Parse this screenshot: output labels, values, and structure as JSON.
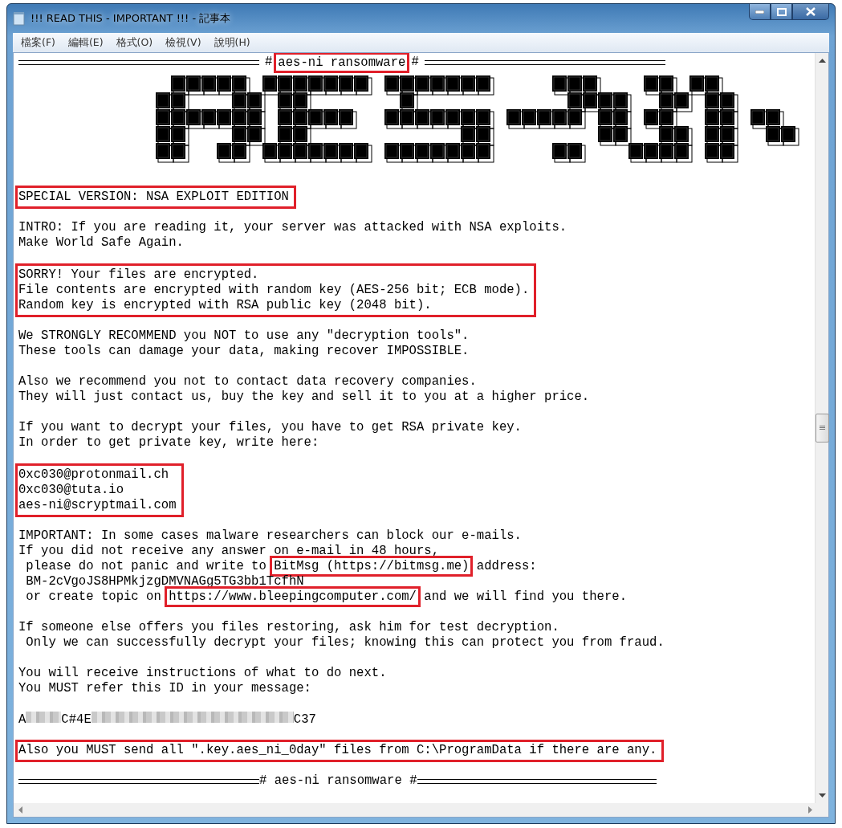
{
  "window": {
    "title": "!!! READ THIS - IMPORTANT !!! - 記事本"
  },
  "menu": [
    {
      "label": "檔案(F)"
    },
    {
      "label": "編輯(E)"
    },
    {
      "label": "格式(O)"
    },
    {
      "label": "檢視(V)"
    },
    {
      "label": "說明(H)"
    }
  ],
  "header": [
    {
      "text": "#",
      "boxed": false
    },
    {
      "text": "aes-ni ransomware",
      "boxed": true
    },
    {
      "text": "#",
      "boxed": false
    }
  ],
  "blocks": [
    {
      "boxed": true,
      "lines": [
        [
          {
            "text": "SPECIAL VERSION: NSA EXPLOIT EDITION",
            "boxed": false
          }
        ]
      ]
    },
    {
      "boxed": false,
      "lines": [
        [
          {
            "text": "INTRO: If you are reading it, your server was attacked with NSA exploits.",
            "boxed": false
          }
        ],
        [
          {
            "text": "Make World Safe Again.",
            "boxed": false
          }
        ]
      ]
    },
    {
      "boxed": true,
      "lines": [
        [
          {
            "text": "SORRY! Your files are encrypted.",
            "boxed": false
          }
        ],
        [
          {
            "text": "File contents are encrypted with random key (AES-256 bit; ECB mode).",
            "boxed": false
          }
        ],
        [
          {
            "text": "Random key is encrypted with RSA public key (2048 bit).",
            "boxed": false
          }
        ]
      ]
    },
    {
      "boxed": false,
      "lines": [
        [
          {
            "text": "We STRONGLY RECOMMEND you NOT to use any \"decryption tools\".",
            "boxed": false
          }
        ],
        [
          {
            "text": "These tools can damage your data, making recover IMPOSSIBLE.",
            "boxed": false
          }
        ]
      ]
    },
    {
      "boxed": false,
      "lines": [
        [
          {
            "text": "Also we recommend you not to contact data recovery companies.",
            "boxed": false
          }
        ],
        [
          {
            "text": "They will just contact us, buy the key and sell it to you at a higher price.",
            "boxed": false
          }
        ]
      ]
    },
    {
      "boxed": false,
      "lines": [
        [
          {
            "text": "If you want to decrypt your files, you have to get RSA private key.",
            "boxed": false
          }
        ],
        [
          {
            "text": "In order to get private key, write here:",
            "boxed": false
          }
        ]
      ]
    },
    {
      "boxed": true,
      "lines": [
        [
          {
            "text": "0xc030@protonmail.ch",
            "boxed": false
          }
        ],
        [
          {
            "text": "0xc030@tuta.io",
            "boxed": false
          }
        ],
        [
          {
            "text": "aes-ni@scryptmail.com",
            "boxed": false
          }
        ]
      ]
    },
    {
      "boxed": false,
      "lines": [
        [
          {
            "text": "IMPORTANT: In some cases malware researchers can block our e-mails.",
            "boxed": false
          }
        ],
        [
          {
            "text": "If you did not receive any answer on e-mail in 48 hours,",
            "boxed": false
          }
        ],
        [
          {
            "text": " please do not panic and write to ",
            "boxed": false
          },
          {
            "text": "BitMsg (https://bitmsg.me)",
            "boxed": true
          },
          {
            "text": " address:",
            "boxed": false
          }
        ],
        [
          {
            "text": " BM-2cVgoJS8HPMkjzgDMVNAGg5TG3bb1TcfhN",
            "boxed": false
          }
        ],
        [
          {
            "text": " or create topic on ",
            "boxed": false
          },
          {
            "text": "https://www.bleepingcomputer.com/",
            "boxed": true
          },
          {
            "text": " and we will find you there.",
            "boxed": false
          }
        ]
      ]
    },
    {
      "boxed": false,
      "lines": [
        [
          {
            "text": "If someone else offers you files restoring, ask him for test decryption.",
            "boxed": false
          }
        ],
        [
          {
            "text": " Only we can successfully decrypt your files; knowing this can protect you from fraud.",
            "boxed": false
          }
        ]
      ]
    },
    {
      "boxed": false,
      "lines": [
        [
          {
            "text": "You will receive instructions of what to do next.",
            "boxed": false
          }
        ],
        [
          {
            "text": "You MUST refer this ID in your message:",
            "boxed": false
          }
        ]
      ]
    },
    {
      "boxed": false,
      "lines": [
        [
          {
            "text": "A",
            "boxed": false
          },
          {
            "kind": "redacted"
          },
          {
            "text": "C#4E",
            "boxed": false
          },
          {
            "kind": "redacted"
          },
          {
            "text": "C37",
            "boxed": false
          }
        ]
      ]
    },
    {
      "boxed": true,
      "tight": true,
      "lines": [
        [
          {
            "text": "Also you MUST send all \".key.aes_ni_0day\" files from C:\\ProgramData if there are any.",
            "boxed": false
          }
        ]
      ]
    }
  ],
  "footer": {
    "text": "# aes-ni ransomware #"
  }
}
